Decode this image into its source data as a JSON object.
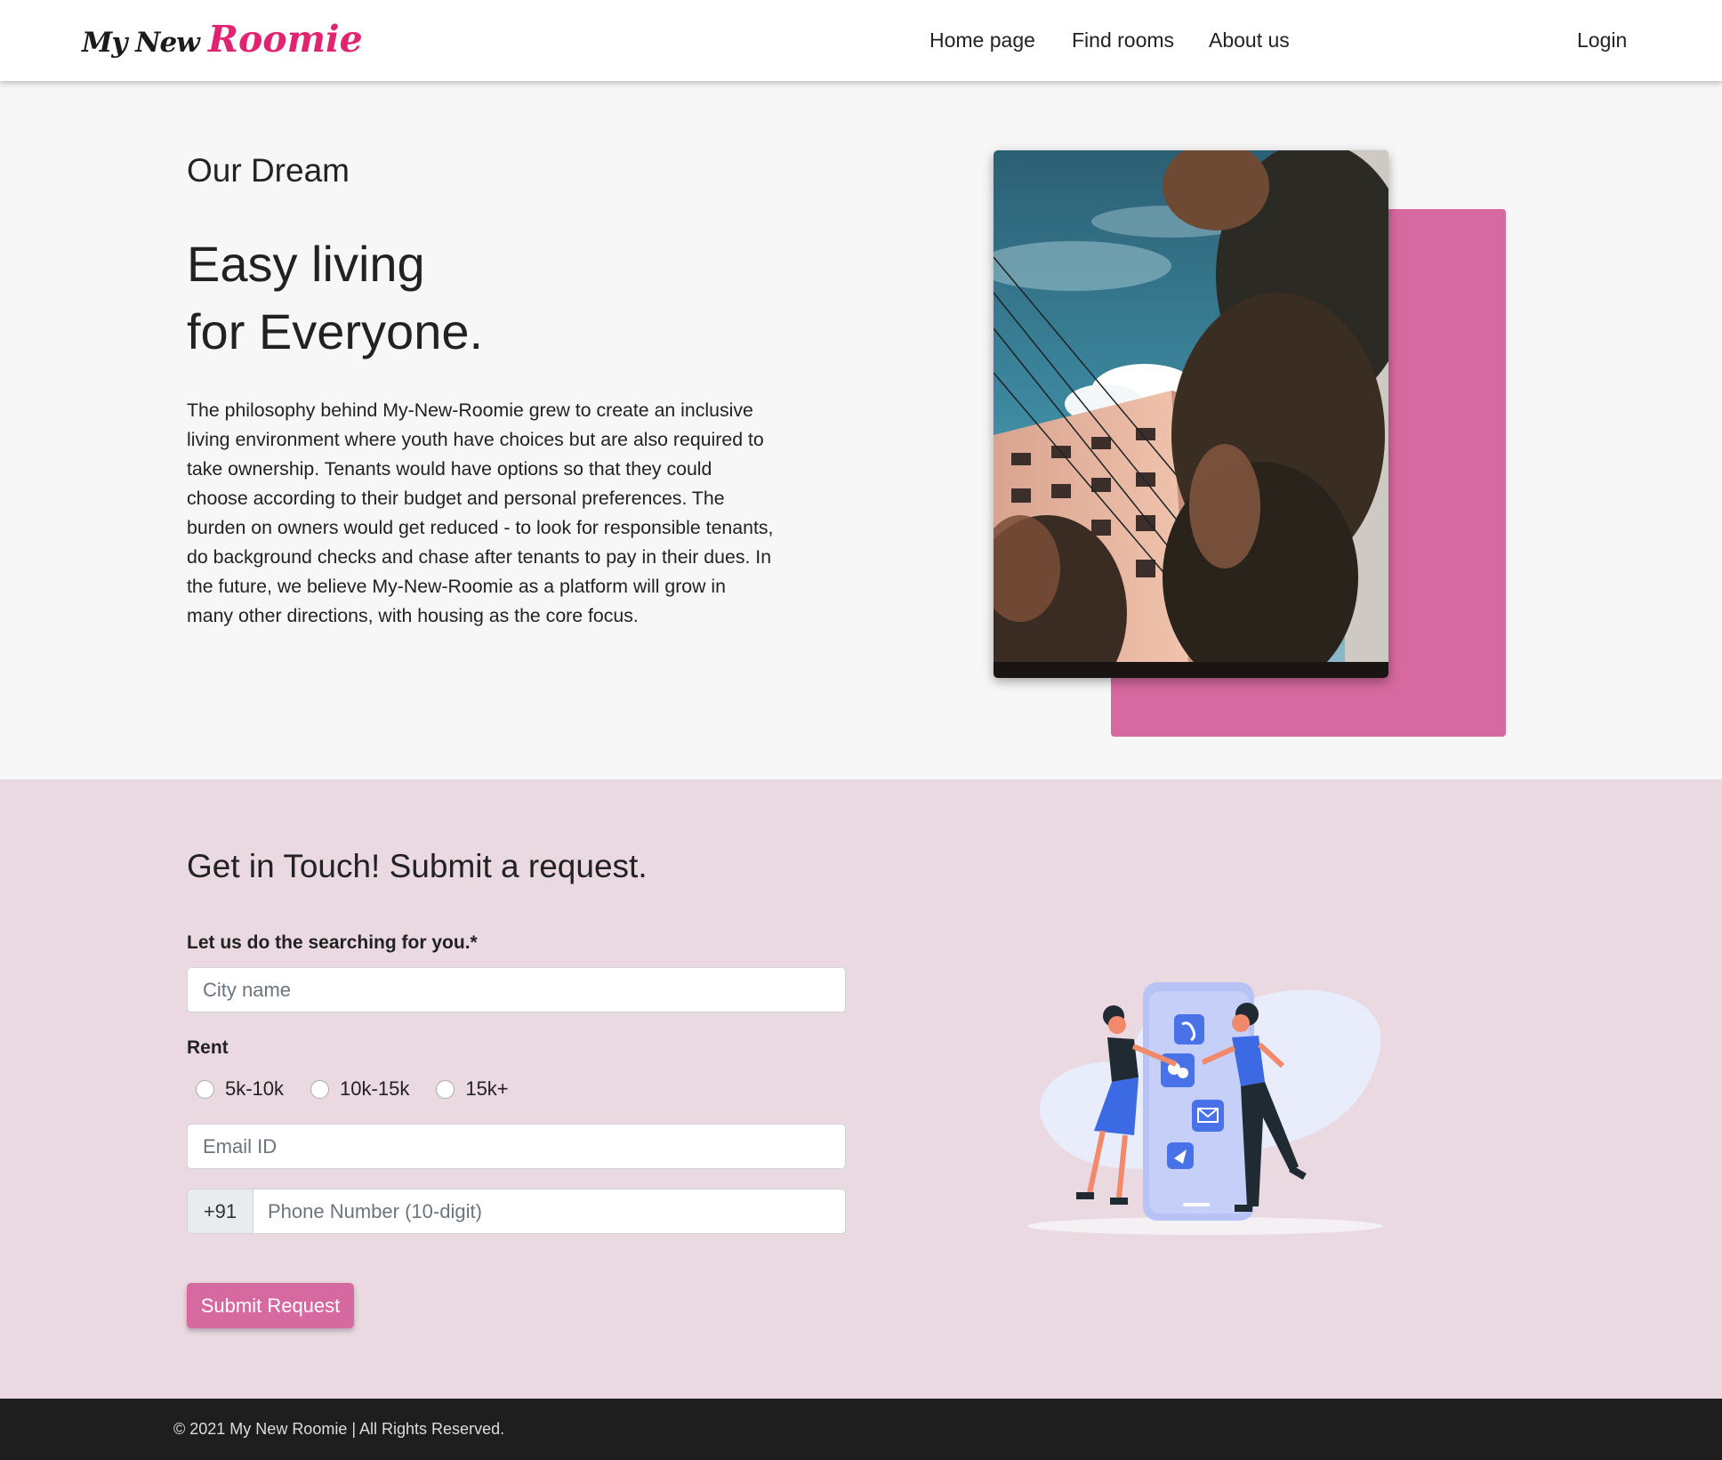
{
  "nav": {
    "logo_part1": "My New",
    "logo_part2": "Roomie",
    "links": [
      "Home page",
      "Find rooms",
      "About us"
    ],
    "login": "Login"
  },
  "hero": {
    "eyebrow": "Our Dream",
    "headline_line1": "Easy living",
    "headline_line2": "for Everyone.",
    "description": "The philosophy behind My-New-Roomie grew to create an inclusive living environment where youth have choices but are also required to take ownership. Tenants would have options so that they could choose according to their budget and personal preferences. The burden on owners would get reduced - to look for responsible tenants, do background checks and chase after tenants to pay in their dues. In the future, we believe My-New-Roomie as a platform will grow in many other directions, with housing as the core focus."
  },
  "contact": {
    "title": "Get in Touch! Submit a request.",
    "search_label": "Let us do the searching for you.*",
    "city_placeholder": "City name",
    "rent_label": "Rent",
    "rent_options": [
      "5k-10k",
      "10k-15k",
      "15k+"
    ],
    "email_placeholder": "Email ID",
    "phone_prefix": "+91",
    "phone_placeholder": "Phone Number (10-digit)",
    "submit_label": "Submit Request"
  },
  "footer": {
    "copyright": "© 2021 My New Roomie | All Rights Reserved."
  },
  "colors": {
    "accent_pink": "#d6699f",
    "logo_pink": "#e0246f",
    "contact_bg": "#ead9e1",
    "footer_bg": "#1e1e1f"
  }
}
